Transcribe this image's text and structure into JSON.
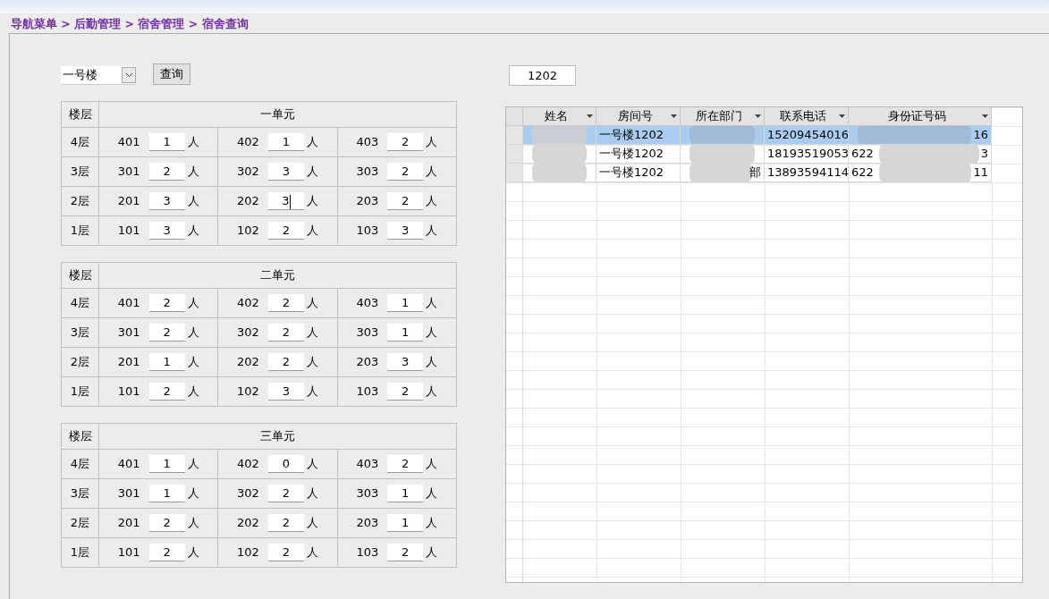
{
  "breadcrumb": "导航菜单 > 后勤管理 > 宿舍管理 > 宿舍查询",
  "building_select": {
    "value": "一号楼"
  },
  "query_button": "查询",
  "room_field": {
    "value": "1202"
  },
  "units": [
    {
      "floor_header": "楼层",
      "title": "一单元",
      "floors": [
        {
          "label": "4层",
          "rooms": [
            {
              "room": "401",
              "count": "1",
              "unit": "人"
            },
            {
              "room": "402",
              "count": "1",
              "unit": "人"
            },
            {
              "room": "403",
              "count": "2",
              "unit": "人"
            }
          ]
        },
        {
          "label": "3层",
          "rooms": [
            {
              "room": "301",
              "count": "2",
              "unit": "人"
            },
            {
              "room": "302",
              "count": "3",
              "unit": "人"
            },
            {
              "room": "303",
              "count": "2",
              "unit": "人"
            }
          ]
        },
        {
          "label": "2层",
          "rooms": [
            {
              "room": "201",
              "count": "3",
              "unit": "人"
            },
            {
              "room": "202",
              "count": "3",
              "unit": "人",
              "focused": true
            },
            {
              "room": "203",
              "count": "2",
              "unit": "人"
            }
          ]
        },
        {
          "label": "1层",
          "rooms": [
            {
              "room": "101",
              "count": "3",
              "unit": "人"
            },
            {
              "room": "102",
              "count": "2",
              "unit": "人"
            },
            {
              "room": "103",
              "count": "3",
              "unit": "人"
            }
          ]
        }
      ]
    },
    {
      "floor_header": "楼层",
      "title": "二单元",
      "floors": [
        {
          "label": "4层",
          "rooms": [
            {
              "room": "401",
              "count": "2",
              "unit": "人"
            },
            {
              "room": "402",
              "count": "2",
              "unit": "人"
            },
            {
              "room": "403",
              "count": "1",
              "unit": "人"
            }
          ]
        },
        {
          "label": "3层",
          "rooms": [
            {
              "room": "301",
              "count": "2",
              "unit": "人"
            },
            {
              "room": "302",
              "count": "2",
              "unit": "人"
            },
            {
              "room": "303",
              "count": "1",
              "unit": "人"
            }
          ]
        },
        {
          "label": "2层",
          "rooms": [
            {
              "room": "201",
              "count": "1",
              "unit": "人"
            },
            {
              "room": "202",
              "count": "2",
              "unit": "人"
            },
            {
              "room": "203",
              "count": "3",
              "unit": "人"
            }
          ]
        },
        {
          "label": "1层",
          "rooms": [
            {
              "room": "101",
              "count": "2",
              "unit": "人"
            },
            {
              "room": "102",
              "count": "3",
              "unit": "人"
            },
            {
              "room": "103",
              "count": "2",
              "unit": "人"
            }
          ]
        }
      ]
    },
    {
      "floor_header": "楼层",
      "title": "三单元",
      "floors": [
        {
          "label": "4层",
          "rooms": [
            {
              "room": "401",
              "count": "1",
              "unit": "人"
            },
            {
              "room": "402",
              "count": "0",
              "unit": "人"
            },
            {
              "room": "403",
              "count": "2",
              "unit": "人"
            }
          ]
        },
        {
          "label": "3层",
          "rooms": [
            {
              "room": "301",
              "count": "1",
              "unit": "人"
            },
            {
              "room": "302",
              "count": "2",
              "unit": "人"
            },
            {
              "room": "303",
              "count": "1",
              "unit": "人"
            }
          ]
        },
        {
          "label": "2层",
          "rooms": [
            {
              "room": "201",
              "count": "2",
              "unit": "人"
            },
            {
              "room": "202",
              "count": "2",
              "unit": "人"
            },
            {
              "room": "203",
              "count": "1",
              "unit": "人"
            }
          ]
        },
        {
          "label": "1层",
          "rooms": [
            {
              "room": "101",
              "count": "2",
              "unit": "人"
            },
            {
              "room": "102",
              "count": "2",
              "unit": "人"
            },
            {
              "room": "103",
              "count": "2",
              "unit": "人"
            }
          ]
        }
      ]
    }
  ],
  "grid": {
    "columns": [
      "姓名",
      "房间号",
      "所在部门",
      "联系电话",
      "身份证号码"
    ],
    "rows": [
      {
        "selected": true,
        "cells": [
          {
            "blurred": true
          },
          {
            "text": "一号楼1202"
          },
          {
            "blurred": true
          },
          {
            "text": "15209454016"
          },
          {
            "blurred": true,
            "end": "16"
          }
        ]
      },
      {
        "selected": false,
        "cells": [
          {
            "blurred": true
          },
          {
            "text": "一号楼1202"
          },
          {
            "blurred": true
          },
          {
            "text": "18193519053"
          },
          {
            "blurred": true,
            "start": "622",
            "end": "3"
          }
        ]
      },
      {
        "selected": false,
        "cells": [
          {
            "blurred": true
          },
          {
            "text": "一号楼1202"
          },
          {
            "blurred": true,
            "end": "部"
          },
          {
            "text": "13893594114"
          },
          {
            "blurred": true,
            "start": "622",
            "end": "11"
          }
        ]
      }
    ]
  }
}
